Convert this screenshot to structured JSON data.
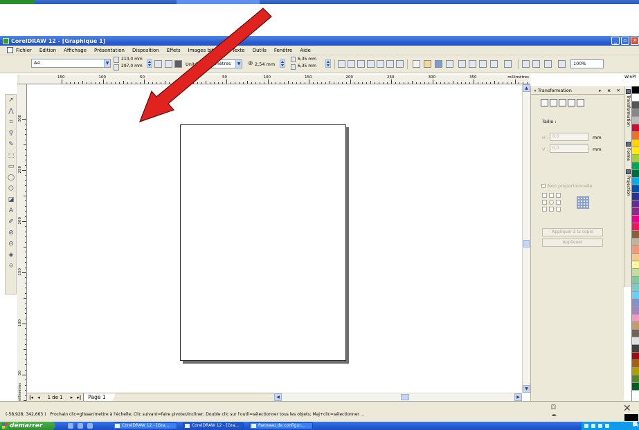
{
  "window": {
    "title": "CorelDRAW 12 - [Graphique 1]"
  },
  "menu": [
    "Fichier",
    "Edition",
    "Affichage",
    "Présentation",
    "Disposition",
    "Effets",
    "Images bitmap",
    "Texte",
    "Outils",
    "Fenêtre",
    "Aide"
  ],
  "propbar": {
    "paper_size": "A4",
    "width": "210,0 mm",
    "height": "297,0 mm",
    "units_label": "Unités :",
    "units_value": "millimètres",
    "nudge": "2,54 mm",
    "dup_x": "6,35 mm",
    "dup_y": "6,35 mm",
    "zoom": "100%"
  },
  "ruler": {
    "top_ticks": [
      "150",
      "100",
      "50",
      "0",
      "50",
      "100",
      "150",
      "200",
      "250",
      "300",
      "350",
      "400"
    ],
    "unit": "millimètres",
    "left_ticks": [
      "300",
      "250",
      "200",
      "150",
      "100",
      "50",
      "0"
    ],
    "left_unit": "millimètres"
  },
  "docker": {
    "header": "Transformation",
    "size_label": "Taille :",
    "h_label": "H :",
    "h_value": "0,0",
    "v_label": "V :",
    "v_value": "0,0",
    "unit": "mm",
    "checkbox_label": "Non proportionnelle",
    "apply_copy": "Appliquer à la copie",
    "apply": "Appliquer"
  },
  "sidetabs": [
    "Transformation",
    "Forme",
    "Projection"
  ],
  "winpl": "WinPl",
  "pagenav": {
    "count": "1 de 1",
    "page_tab": "Page 1"
  },
  "status": {
    "coords": "(-58,928; 342,663 )",
    "hint": "Prochain clic=glisser/mettre à l'échelle; Clic suivant=faire pivoter/incliner; Double clic sur l'outil=sélectionner tous les objets; Maj+clic=sélectionner ..."
  },
  "taskbar": {
    "start": "démarrer",
    "tasks": [
      "CorelDRAW 12 - [Gra...",
      "CorelDRAW 12 - [Gra...",
      "Panneau de configur..."
    ],
    "clock": "14:56"
  },
  "palette": [
    "#000000",
    "#ffffff",
    "#555555",
    "#888888",
    "#bbbbbb",
    "#c8102e",
    "#f36f21",
    "#ffd200",
    "#ffed00",
    "#a6ce39",
    "#00a651",
    "#006b3f",
    "#00aeef",
    "#0054a6",
    "#2e3192",
    "#662d91",
    "#92278f",
    "#ec008c",
    "#ed145b",
    "#8b5e3c",
    "#c7b299",
    "#f7977a",
    "#fdc689",
    "#fff799",
    "#c4df9b",
    "#82ca9c",
    "#7accc8",
    "#6dcff6",
    "#8393ca",
    "#a186be",
    "#f49ac1",
    "#c69c6d",
    "#736357",
    "#e0e0e0",
    "#404040",
    "#9e0b0f",
    "#a36209",
    "#aba000",
    "#598527",
    "#005e20"
  ],
  "colors": {
    "titlebar": "#2c5fd1",
    "chrome": "#ece9d8",
    "annotation_arrow": "#e0231e",
    "taskbar": "#245edb",
    "start": "#2f8f2f"
  }
}
